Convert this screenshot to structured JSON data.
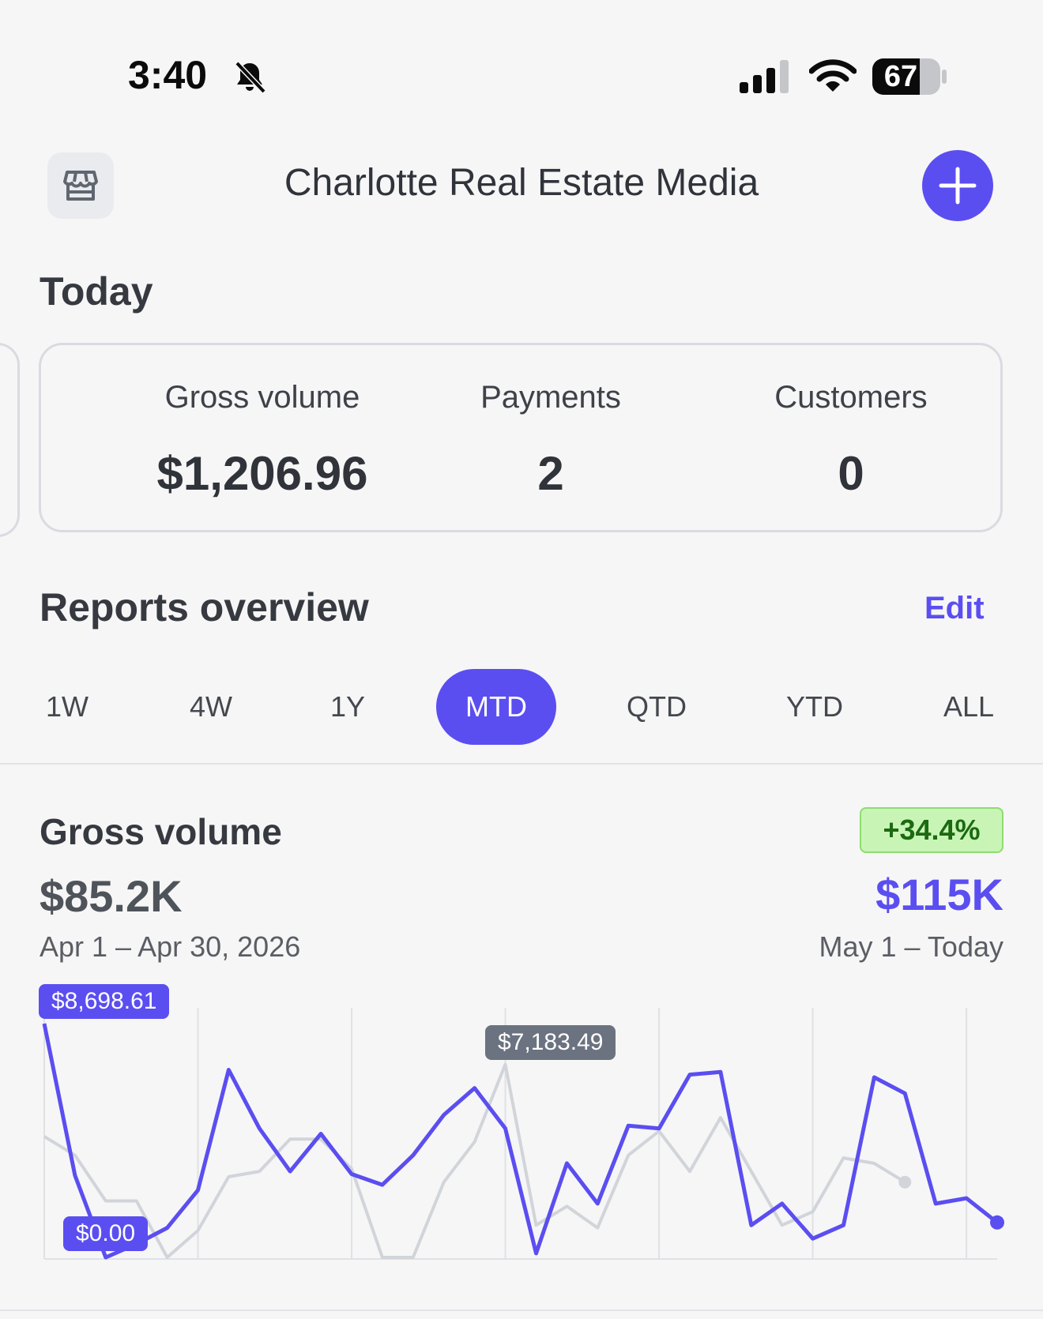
{
  "status_bar": {
    "time": "3:40",
    "battery": "67"
  },
  "header": {
    "title": "Charlotte Real Estate Media"
  },
  "today": {
    "title": "Today",
    "metrics": [
      {
        "label": "Gross volume",
        "value": "$1,206.96"
      },
      {
        "label": "Payments",
        "value": "2"
      },
      {
        "label": "Customers",
        "value": "0"
      }
    ]
  },
  "reports": {
    "title": "Reports overview",
    "edit_label": "Edit",
    "tabs": [
      "1W",
      "4W",
      "1Y",
      "MTD",
      "QTD",
      "YTD",
      "ALL"
    ],
    "active_tab": "MTD"
  },
  "gross_volume": {
    "title": "Gross volume",
    "previous_total": "$85.2K",
    "previous_range": "Apr 1 – Apr 30, 2026",
    "change": "+34.4%",
    "current_total": "$115K",
    "current_range": "May 1 – Today"
  },
  "colors": {
    "accent": "#5b4ef0",
    "previous_series": "#d1d4d9",
    "positive": "#1c6a12"
  },
  "chart_data": {
    "type": "line",
    "annotations": {
      "max_current": "$8,698.61",
      "min_current": "$0.00",
      "max_previous": "$7,183.49"
    },
    "series": [
      {
        "values": [
          8698.61,
          3050,
          0,
          500,
          1100,
          2500,
          6980,
          4800,
          3200,
          4600,
          3100,
          2700,
          3800,
          5300,
          6300,
          4800,
          150,
          3500,
          2000,
          4900,
          4800,
          6800,
          6900,
          1200,
          2000,
          700,
          1200,
          6700,
          6100,
          2000,
          2200,
          1300
        ]
      },
      {
        "values": [
          4500,
          3800,
          2100,
          2100,
          0,
          1000,
          3000,
          3200,
          4400,
          4400,
          3300,
          0,
          0,
          2800,
          4300,
          7183.49,
          1200,
          1900,
          1100,
          3800,
          4700,
          3200,
          5200,
          3200,
          1200,
          1700,
          3700,
          3500,
          2800
        ]
      }
    ]
  }
}
